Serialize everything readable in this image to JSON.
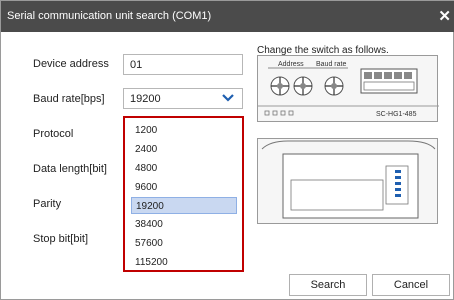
{
  "window": {
    "title": "Serial communication unit search (COM1)",
    "close_glyph": "✕"
  },
  "form": {
    "device_address_label": "Device address",
    "device_address_value": "01",
    "baud_rate_label": "Baud rate[bps]",
    "baud_rate_value": "19200",
    "protocol_label": "Protocol",
    "data_length_label": "Data length[bit]",
    "parity_label": "Parity",
    "stop_bit_label": "Stop bit[bit]"
  },
  "dropdown": {
    "options": [
      "1200",
      "2400",
      "4800",
      "9600",
      "19200",
      "38400",
      "57600",
      "115200"
    ],
    "selected": "19200"
  },
  "diagram": {
    "title": "Change the switch as follows.",
    "address_label": "Address",
    "baud_label": "Baud rate",
    "model": "SC-HG1-485"
  },
  "buttons": {
    "search": "Search",
    "cancel": "Cancel"
  },
  "colors": {
    "titlebar": "#4b4b4b",
    "highlight_border": "#c00000",
    "selected_bg": "#c9d8f1"
  }
}
